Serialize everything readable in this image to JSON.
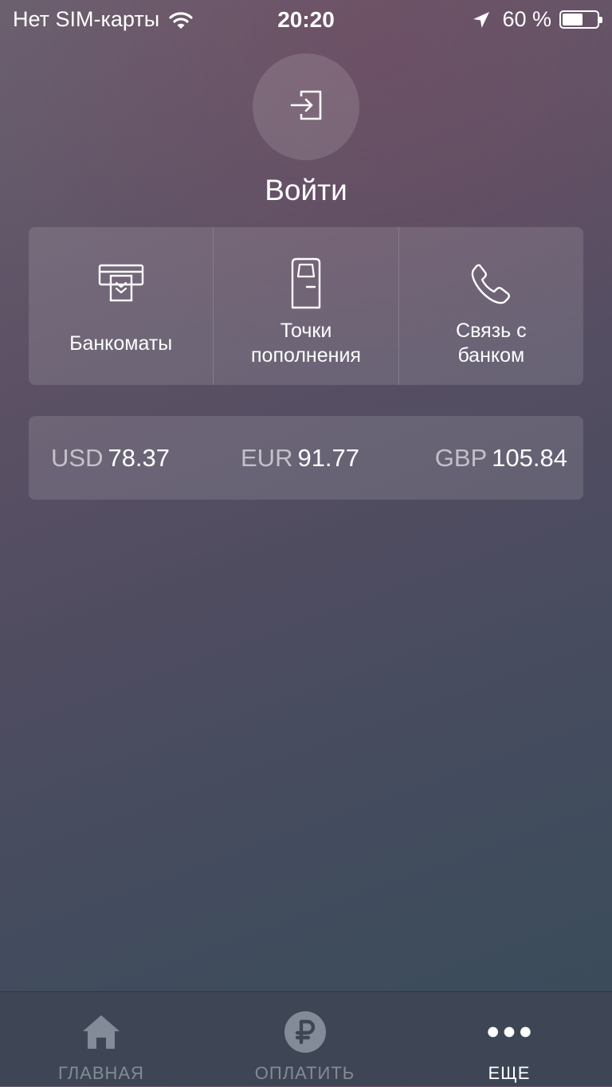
{
  "status_bar": {
    "carrier": "Нет SIM-карты",
    "time": "20:20",
    "battery_percent": "60 %",
    "battery_level": 0.6,
    "icons": [
      "wifi-icon",
      "location-arrow-icon",
      "battery-icon"
    ]
  },
  "login": {
    "icon": "login-icon",
    "label": "Войти"
  },
  "quick_actions": [
    {
      "icon": "atm-icon",
      "label": "Банкоматы"
    },
    {
      "icon": "terminal-icon",
      "label": "Точки\nпополнения"
    },
    {
      "icon": "phone-icon",
      "label": "Связь с\nбанком"
    }
  ],
  "rates": [
    {
      "code": "USD",
      "value": "78.37"
    },
    {
      "code": "EUR",
      "value": "91.77"
    },
    {
      "code": "GBP",
      "value": "105.84"
    }
  ],
  "tab_bar": {
    "tabs": [
      {
        "icon": "home-icon",
        "label": "ГЛАВНАЯ",
        "active": false
      },
      {
        "icon": "ruble-icon",
        "label": "ОПЛАТИТЬ",
        "active": false
      },
      {
        "icon": "more-dots-icon",
        "label": "ЕЩЕ",
        "active": true
      }
    ]
  },
  "colors": {
    "tab_bar_bg": "#3e4656",
    "tab_inactive": "#838b98",
    "tab_active": "#ffffff"
  }
}
